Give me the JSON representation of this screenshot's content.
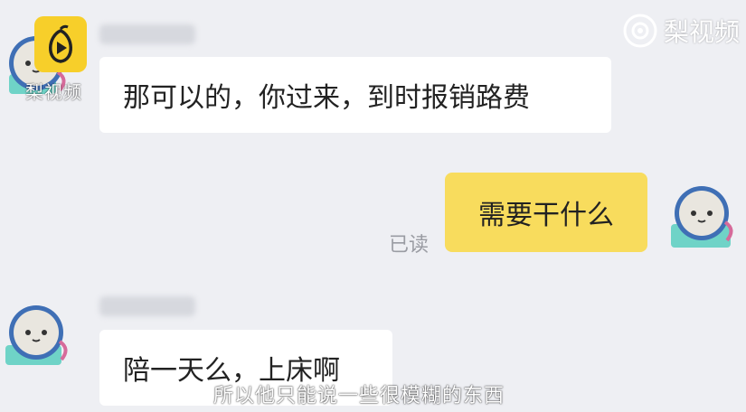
{
  "watermark": {
    "logo_text": "梨视频",
    "right_text": "梨视频",
    "logo_icon": "play-icon"
  },
  "messages": [
    {
      "side": "left",
      "sender_blurred": true,
      "text": "那可以的，你过来，到时报销路费"
    },
    {
      "side": "right",
      "status": "已读",
      "text": "需要干什么"
    },
    {
      "side": "left",
      "sender_blurred": true,
      "text": "陪一天么，上床啊"
    }
  ],
  "subtitle": "所以他只能说一些很模糊的东西",
  "colors": {
    "background": "#eeeff3",
    "self_bubble": "#f8dc5d",
    "other_bubble": "#ffffff",
    "logo": "#f7cf2a"
  }
}
